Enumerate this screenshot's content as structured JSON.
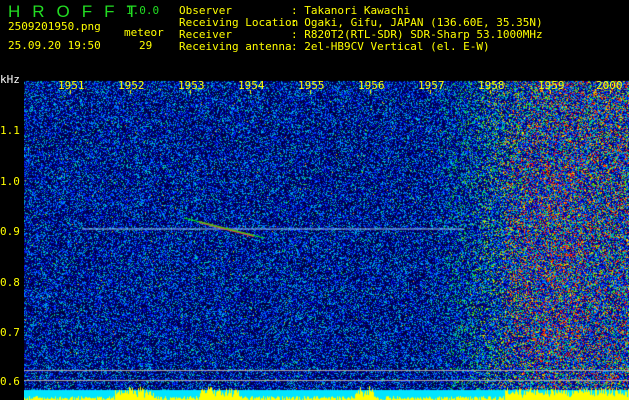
{
  "app": {
    "title": "HROFFT",
    "version": "1.0.0"
  },
  "file": {
    "name": "2509201950.png",
    "datetime": "25.09.20 19:50"
  },
  "meteor": {
    "label": "meteor",
    "count": "29"
  },
  "info": [
    {
      "label": "Observer",
      "value": ": Takanori Kawachi"
    },
    {
      "label": "Receiving Location",
      "value": ": Ogaki, Gifu, JAPAN (136.60E, 35.35N)"
    },
    {
      "label": "Receiver",
      "value": ": R820T2(RTL-SDR) SDR-Sharp 53.1000MHz"
    },
    {
      "label": "Receiving antenna",
      "value": ": 2el-HB9CV Vertical (el. E-W)"
    }
  ],
  "axis": {
    "y_unit": "kHz",
    "y_ticks": [
      "1.1",
      "1.0",
      "0.9",
      "0.8",
      "0.7",
      "0.6"
    ],
    "x_ticks": [
      "1951",
      "1952",
      "1953",
      "1954",
      "1955",
      "1956",
      "1957",
      "1958",
      "1959",
      "2000"
    ]
  }
}
